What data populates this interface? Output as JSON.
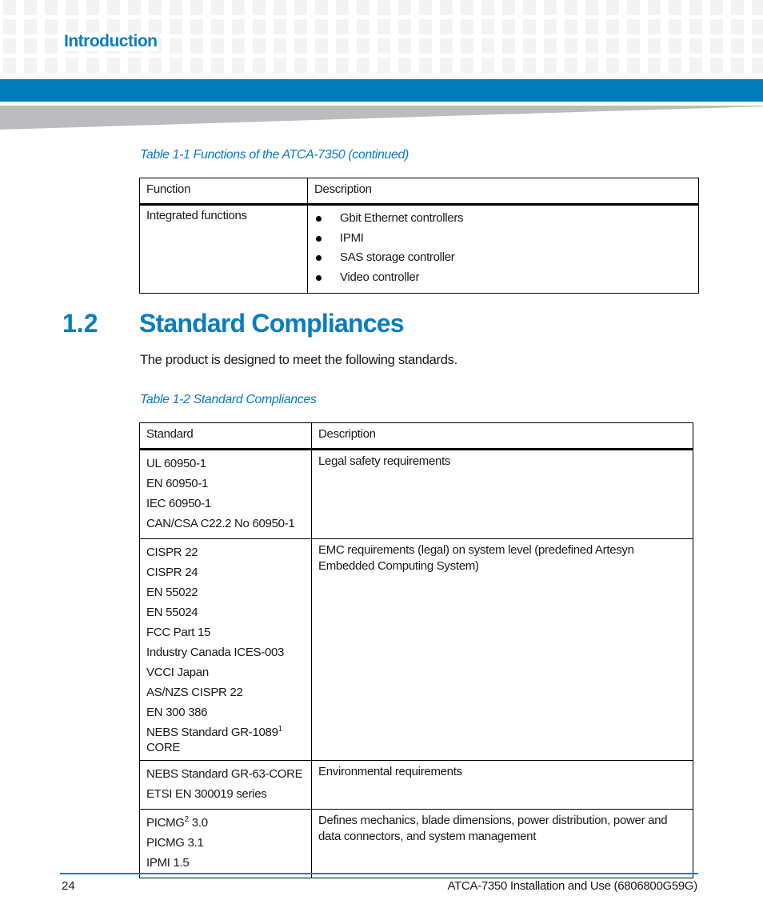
{
  "header": {
    "chapter": "Introduction",
    "colors": {
      "accent": "#007cbb",
      "wedge": "#bcbcbe",
      "grid": "#f3f3f3"
    }
  },
  "table1": {
    "caption": "Table 1-1 Functions of the ATCA-7350 (continued)",
    "columns": [
      "Function",
      "Description"
    ],
    "rows": [
      {
        "function": "Integrated functions",
        "items": [
          "Gbit Ethernet controllers",
          "IPMI",
          "SAS storage controller",
          "Video controller"
        ]
      }
    ]
  },
  "section": {
    "number": "1.2",
    "title": "Standard Compliances",
    "intro": "The product is designed to meet the following standards."
  },
  "table2": {
    "caption": "Table 1-2 Standard Compliances",
    "columns": [
      "Standard",
      "Description"
    ],
    "rows": [
      {
        "standards": [
          "UL 60950-1",
          "EN 60950-1",
          "IEC 60950-1",
          "CAN/CSA C22.2 No 60950-1"
        ],
        "description": "Legal safety requirements"
      },
      {
        "standards": [
          "CISPR 22",
          "CISPR 24",
          "EN 55022",
          "EN 55024",
          "FCC Part 15",
          "Industry Canada ICES-003",
          "VCCI Japan",
          "AS/NZS CISPR 22",
          "EN 300 386"
        ],
        "nebs": {
          "text": "NEBS Standard GR-1089",
          "sup": "1",
          "tail": "CORE"
        },
        "description": "EMC requirements (legal) on system level (predefined Artesyn Embedded Computing System)"
      },
      {
        "standards": [
          "NEBS Standard GR-63-CORE",
          "ETSI EN 300019 series"
        ],
        "description": "Environmental requirements"
      },
      {
        "picmg": {
          "text": "PICMG",
          "sup": "2",
          "tail": " 3.0"
        },
        "standards": [
          "PICMG 3.1",
          "IPMI 1.5"
        ],
        "description": "Defines mechanics, blade dimensions, power distribution, power and data connectors, and system management"
      }
    ]
  },
  "footer": {
    "page_number": "24",
    "doc_title": "ATCA-7350 Installation and Use (6806800G59G)"
  }
}
